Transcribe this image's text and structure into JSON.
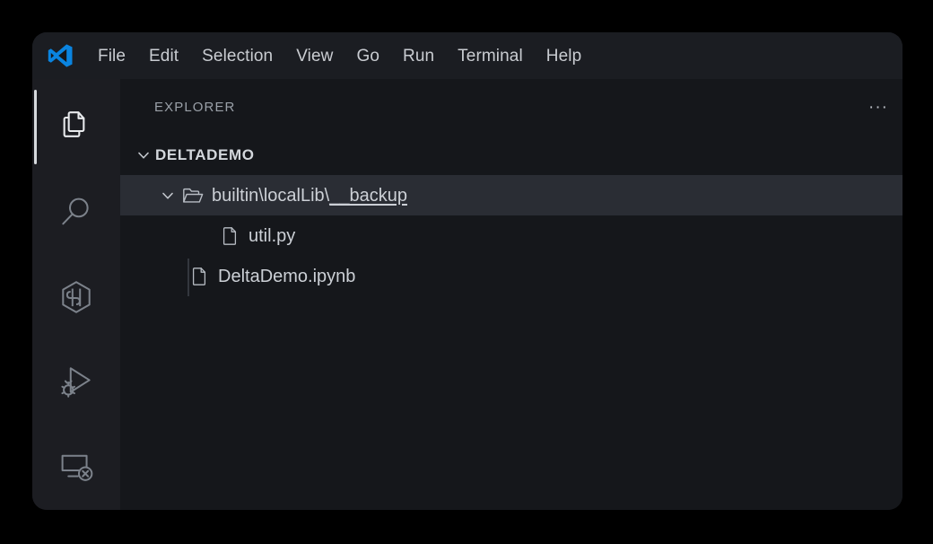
{
  "window": {
    "app_logo_icon": "vscode-logo-icon",
    "accent_color": "#0a84e0",
    "background_color": "#1b1d22",
    "sidebar_color": "#15171b",
    "activitybar_color": "#1c1d22",
    "selection_color": "#2a2d34"
  },
  "menubar": {
    "items": [
      {
        "label": "File"
      },
      {
        "label": "Edit"
      },
      {
        "label": "Selection"
      },
      {
        "label": "View"
      },
      {
        "label": "Go"
      },
      {
        "label": "Run"
      },
      {
        "label": "Terminal"
      },
      {
        "label": "Help"
      }
    ]
  },
  "activitybar": {
    "items": [
      {
        "name": "explorer",
        "icon": "files-icon",
        "active": true
      },
      {
        "name": "search",
        "icon": "search-icon",
        "active": false
      },
      {
        "name": "source-control",
        "icon": "source-control-icon",
        "active": false
      },
      {
        "name": "run-and-debug",
        "icon": "run-debug-icon",
        "active": false
      },
      {
        "name": "remote-explorer",
        "icon": "remote-explorer-icon",
        "active": false
      }
    ]
  },
  "sidebar": {
    "title": "EXPLORER",
    "more_actions_label": "···"
  },
  "tree": {
    "root": {
      "label": "DELTADEMO",
      "expanded": true,
      "twisty_icon": "chevron-down-icon"
    },
    "folder": {
      "label_prefix": "builtin\\localLib\\",
      "label_suffix": "__backup",
      "full_label": "builtin\\localLib\\__backup",
      "expanded": true,
      "selected": true,
      "twisty_icon": "chevron-down-icon",
      "folder_icon": "folder-open-icon"
    },
    "files": [
      {
        "label": "util.py",
        "icon": "file-icon",
        "nested": true
      },
      {
        "label": "DeltaDemo.ipynb",
        "icon": "file-icon",
        "nested": false
      }
    ]
  }
}
